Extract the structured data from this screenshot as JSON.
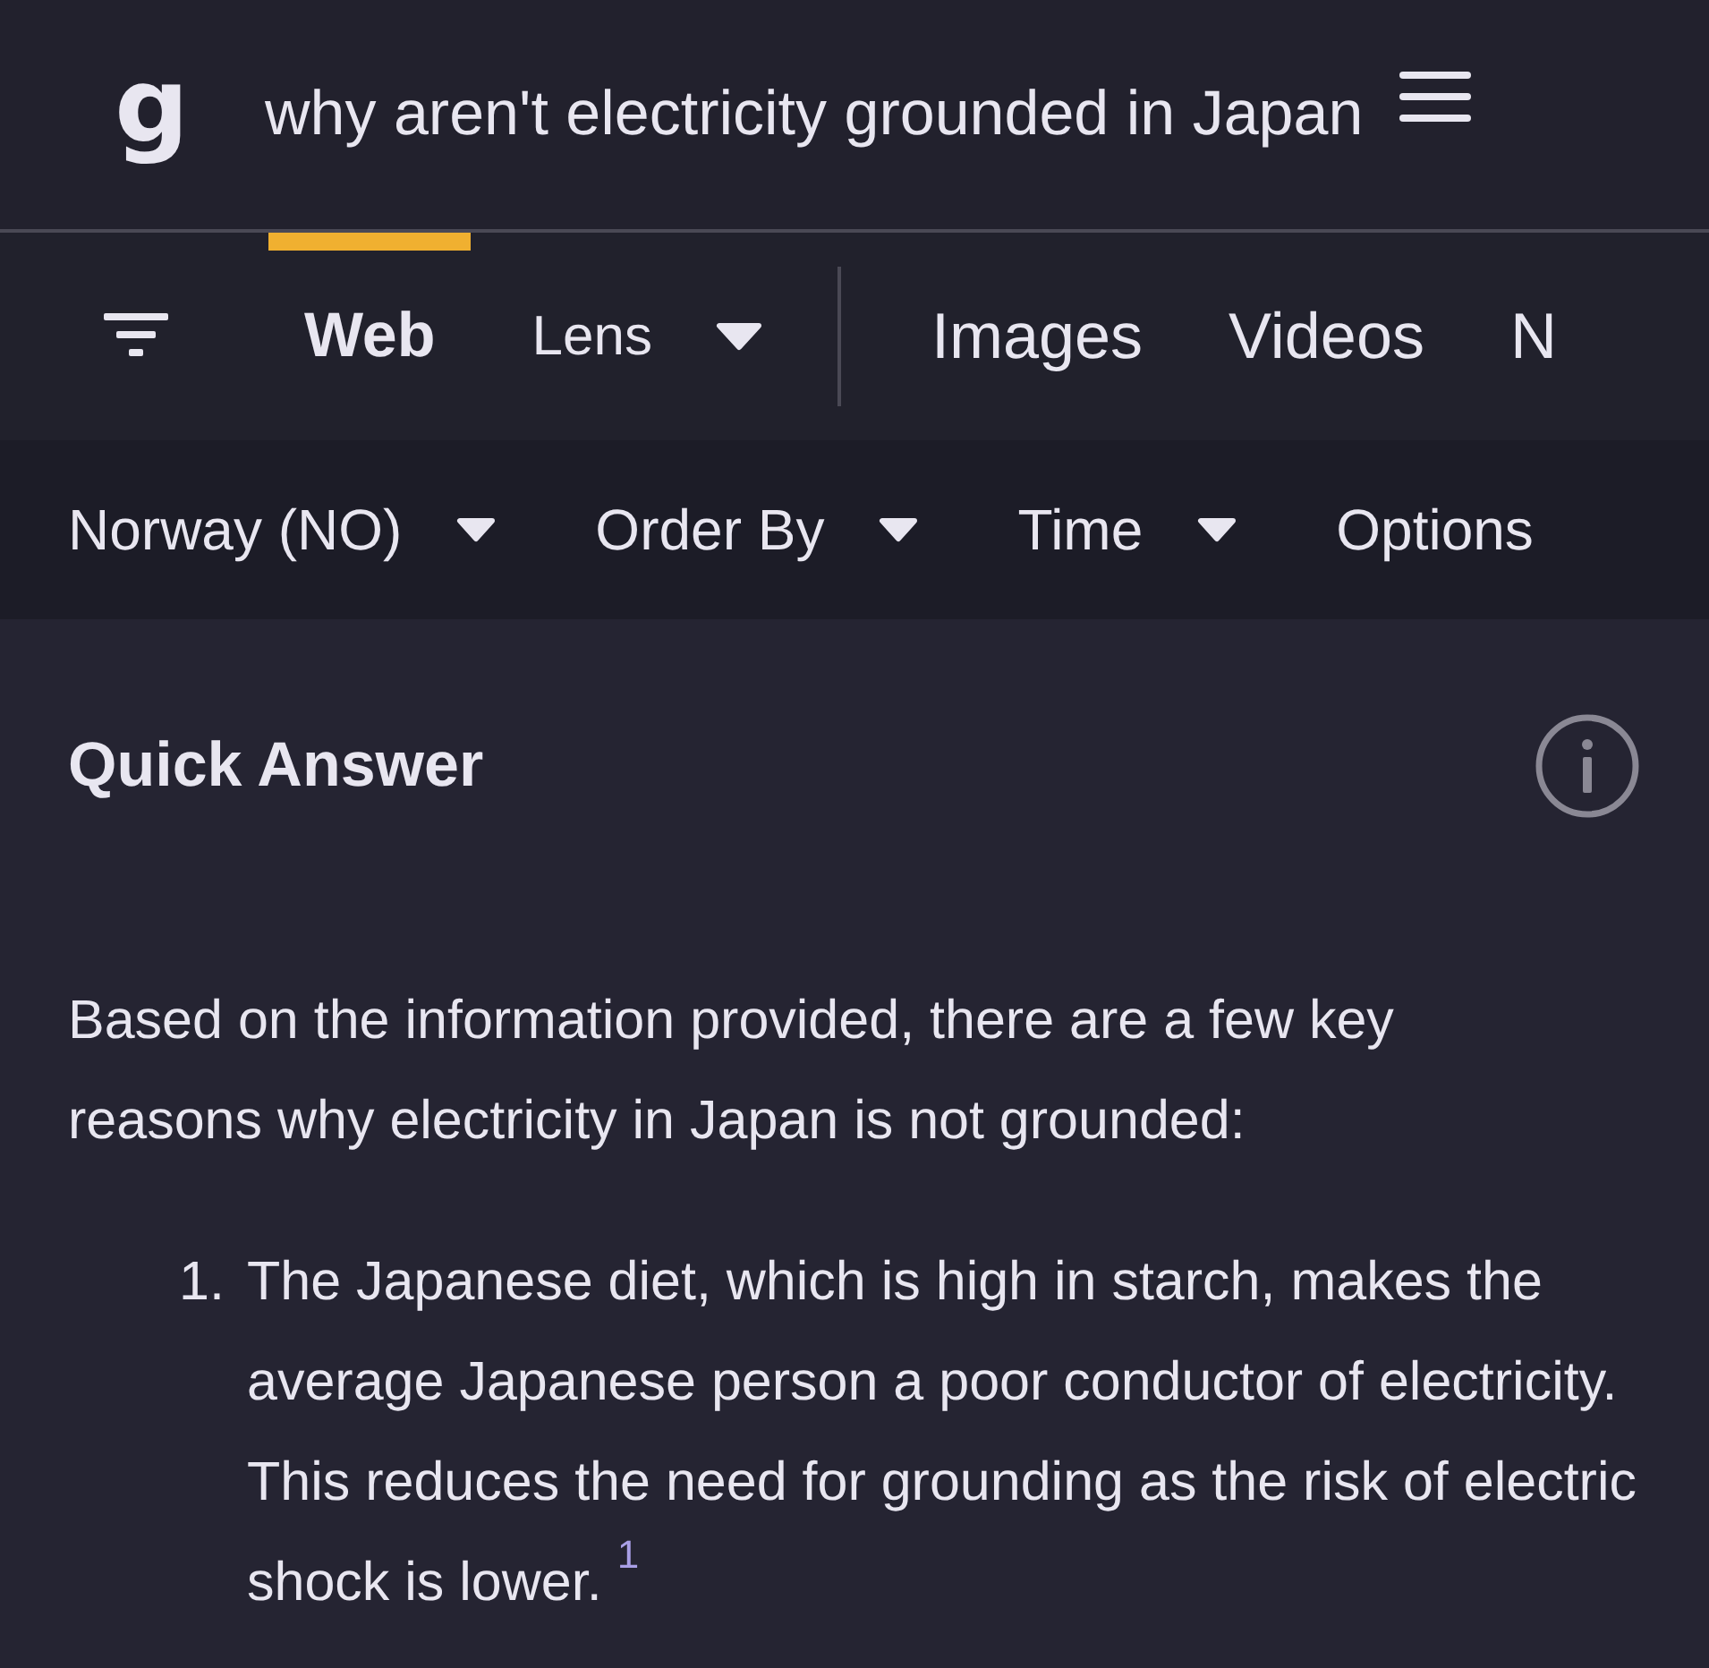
{
  "header": {
    "logo": "g",
    "query": "why aren't electricity grounded in Japan"
  },
  "tabs": [
    {
      "label": "Web",
      "selected": true,
      "dropdown": false
    },
    {
      "label": "Lens",
      "selected": false,
      "dropdown": true
    },
    {
      "label": "Images",
      "selected": false,
      "dropdown": false
    },
    {
      "label": "Videos",
      "selected": false,
      "dropdown": false
    },
    {
      "label": "N",
      "selected": false,
      "dropdown": false
    }
  ],
  "filters": [
    {
      "label": "Norway (NO)",
      "dropdown": true
    },
    {
      "label": "Order By",
      "dropdown": true
    },
    {
      "label": "Time",
      "dropdown": true
    },
    {
      "label": "Options",
      "dropdown": false
    }
  ],
  "quick_answer": {
    "title": "Quick Answer",
    "intro": "Based on the information provided, there are a few key reasons why electricity in Japan is not grounded:",
    "items": [
      {
        "number": "1.",
        "text": "The Japanese diet, which is high in starch, makes the average Japanese person a poor conductor of electricity. This reduces the need for grounding as the risk of electric shock is lower. $^{1}$"
      }
    ]
  }
}
